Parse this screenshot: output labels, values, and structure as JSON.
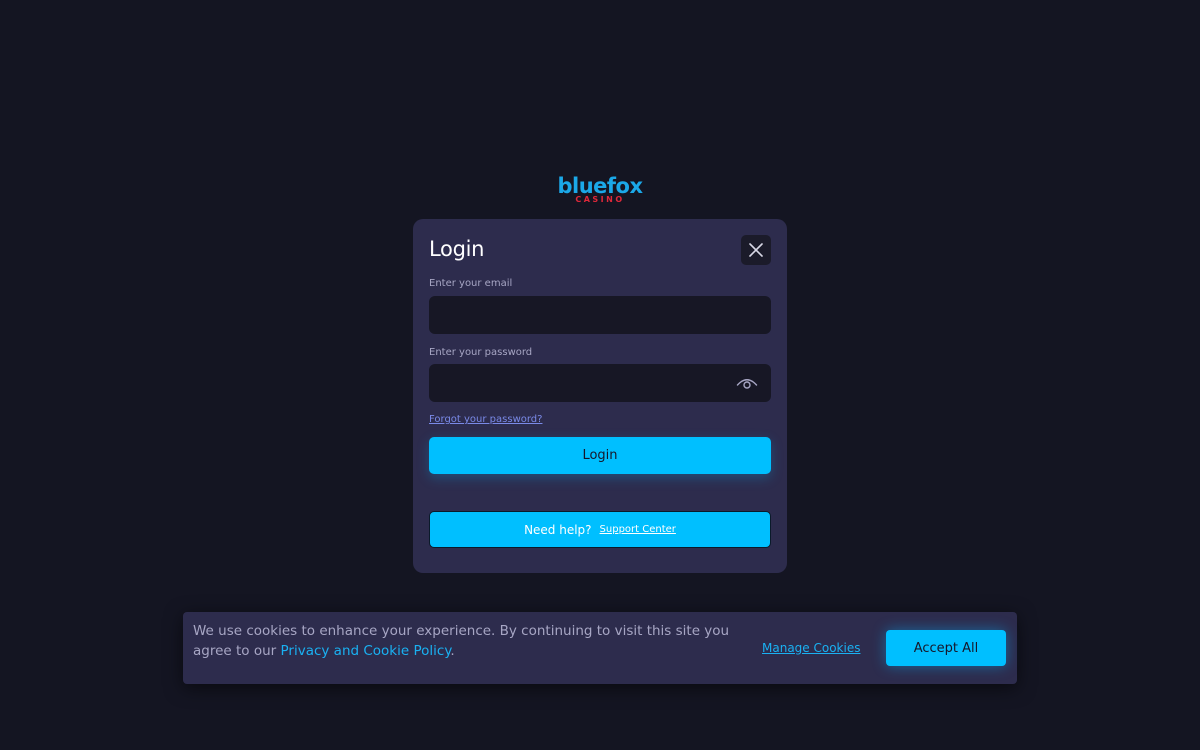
{
  "brand": {
    "logo_main": "bluefox",
    "logo_sub": "CASINO"
  },
  "login_modal": {
    "title": "Login",
    "close_icon": "close-icon",
    "email_label": "Enter your email",
    "email_value": "",
    "password_label": "Enter your password",
    "password_value": "",
    "show_password_icon": "eye-icon",
    "forgot_password": "Forgot your password?",
    "login_button": "Login",
    "help_text": "Need help?",
    "support_link": "Support Center"
  },
  "cookie_banner": {
    "text_prefix": "We use cookies to enhance your experience. By continuing to visit this site you agree to our ",
    "policy_link": "Privacy and Cookie Policy",
    "text_suffix": ".",
    "manage_link": "Manage Cookies",
    "accept_button": "Accept All"
  },
  "colors": {
    "background": "#141522",
    "panel": "#2d2c4d",
    "input": "#171725",
    "accent": "#00bfff",
    "link": "#1ab1f2",
    "logo_blue": "#1ba8e8",
    "logo_red": "#e0283a"
  }
}
